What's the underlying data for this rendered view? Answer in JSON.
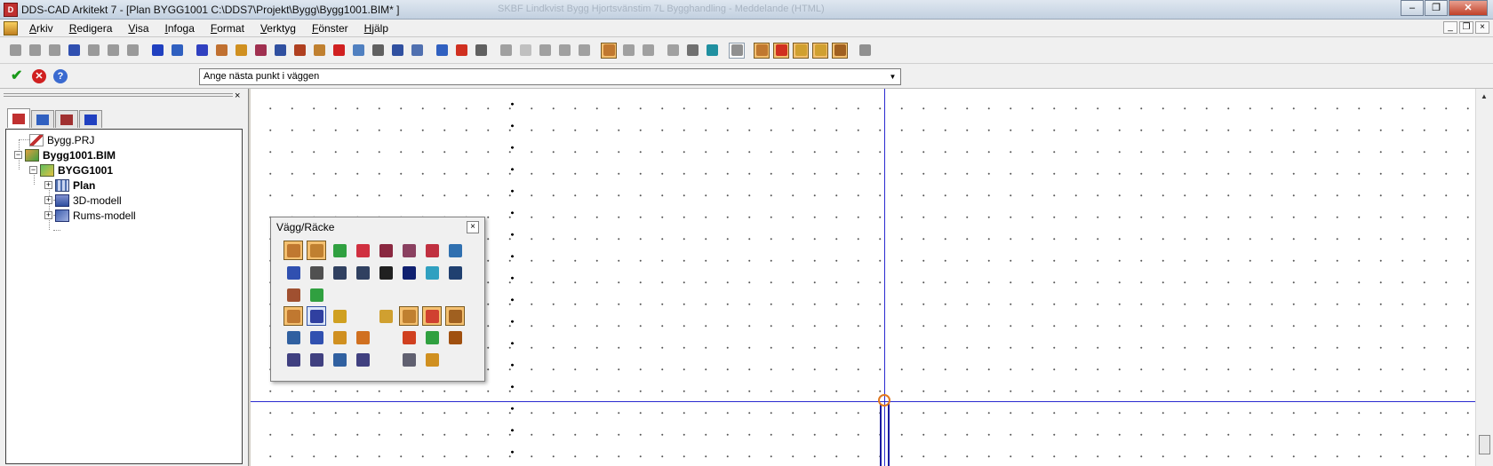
{
  "window": {
    "title": "DDS-CAD Arkitekt 7 - [Plan  BYGG1001  C:\\DDS7\\Projekt\\Bygg\\Bygg1001.BIM* ]",
    "background_title": "SKBF Lindkvist Bygg Hjortsvänstim 7L Bygghandling - Meddelande (HTML)"
  },
  "menu": [
    "Arkiv",
    "Redigera",
    "Visa",
    "Infoga",
    "Format",
    "Verktyg",
    "Fönster",
    "Hjälp"
  ],
  "toolbar": {
    "icons": [
      {
        "name": "copy-icon",
        "color": "#9a9a9a"
      },
      {
        "name": "paste-icon",
        "color": "#9a9a9a"
      },
      {
        "name": "cut-icon",
        "color": "#9a9a9a"
      },
      {
        "name": "save-icon",
        "color": "#3050b0"
      },
      {
        "name": "delete-icon",
        "color": "#9a9a9a"
      },
      {
        "name": "undo-icon",
        "color": "#9a9a9a"
      },
      {
        "name": "redo-icon",
        "color": "#9a9a9a"
      },
      {
        "name": "sep"
      },
      {
        "name": "globe-icon",
        "color": "#2040c0"
      },
      {
        "name": "home-icon",
        "color": "#3060c0"
      },
      {
        "name": "sep"
      },
      {
        "name": "help-icon",
        "color": "#3040c0"
      },
      {
        "name": "floor-plan-icon",
        "color": "#c07030"
      },
      {
        "name": "roof-icon",
        "color": "#d09020"
      },
      {
        "name": "stair-icon",
        "color": "#a03050"
      },
      {
        "name": "window-icon",
        "color": "#3050a0"
      },
      {
        "name": "house-icon",
        "color": "#b04020"
      },
      {
        "name": "beam-icon",
        "color": "#c08030"
      },
      {
        "name": "fire-icon",
        "color": "#d02020"
      },
      {
        "name": "layers-icon",
        "color": "#5080c0"
      },
      {
        "name": "cube-icon",
        "color": "#606060"
      },
      {
        "name": "render-icon",
        "color": "#3050a0"
      },
      {
        "name": "furniture-icon",
        "color": "#5070b0"
      },
      {
        "name": "sep"
      },
      {
        "name": "grid-icon",
        "color": "#3060c0"
      },
      {
        "name": "badge-icon",
        "color": "#d03020"
      },
      {
        "name": "tools-icon",
        "color": "#606060"
      },
      {
        "name": "sep"
      },
      {
        "name": "wall-icon",
        "color": "#a0a0a0"
      },
      {
        "name": "box-icon",
        "color": "#c0c0c0"
      },
      {
        "name": "ellipse-icon",
        "color": "#a0a0a0"
      },
      {
        "name": "cross-icon",
        "color": "#a0a0a0"
      },
      {
        "name": "polygon-icon",
        "color": "#a0a0a0"
      },
      {
        "name": "sep"
      },
      {
        "name": "area-hl-icon",
        "color": "#c07830",
        "hl": true
      },
      {
        "name": "shape-a-icon",
        "color": "#a0a0a0"
      },
      {
        "name": "shape-b-icon",
        "color": "#a0a0a0"
      },
      {
        "name": "sep"
      },
      {
        "name": "mesh-icon",
        "color": "#a0a0a0"
      },
      {
        "name": "camera-icon",
        "color": "#707070"
      },
      {
        "name": "copy-view-icon",
        "color": "#2090a0"
      },
      {
        "name": "sep"
      },
      {
        "name": "image-icon",
        "color": "#909090",
        "framed": true
      },
      {
        "name": "sep"
      },
      {
        "name": "wall-tool-icon",
        "color": "#c07830",
        "hl": true
      },
      {
        "name": "wall-select-icon",
        "color": "#d03020",
        "hl": true
      },
      {
        "name": "dots-icon",
        "color": "#d0a030",
        "hl": true
      },
      {
        "name": "dimension-icon",
        "color": "#d0a030",
        "hl": true
      },
      {
        "name": "column-icon",
        "color": "#a06020",
        "hl": true
      },
      {
        "name": "sep"
      },
      {
        "name": "settings-icon",
        "color": "#909090"
      }
    ]
  },
  "prompt": {
    "text": "Ange nästa punkt i väggen",
    "arrow": "▼"
  },
  "panel": {
    "tabs": [
      {
        "name": "tab-project",
        "color": "#c03030",
        "active": true
      },
      {
        "name": "tab-layers",
        "color": "#3060c0"
      },
      {
        "name": "tab-views",
        "color": "#a03030"
      },
      {
        "name": "tab-links",
        "color": "#2040c0"
      }
    ],
    "tree": {
      "project": "Bygg.PRJ",
      "model": "Bygg1001.BIM",
      "building": "BYGG1001",
      "children": [
        "Plan",
        "3D-modell",
        "Rums-modell"
      ]
    }
  },
  "palette": {
    "title": "Vägg/Räcke",
    "close": "×",
    "rows": [
      [
        {
          "name": "wall-corner-icon",
          "color": "#c07830",
          "hl": true
        },
        {
          "name": "wall-dots-icon",
          "color": "#c08030",
          "hl": true
        },
        {
          "name": "wall-align-icon",
          "color": "#30a040"
        },
        {
          "name": "railing-icon",
          "color": "#d03040"
        },
        {
          "name": "wall-panel-icon",
          "color": "#8a2840"
        },
        {
          "name": "wall-panel-b-icon",
          "color": "#8a4060"
        },
        {
          "name": "wall-frame-icon",
          "color": "#c03040"
        },
        {
          "name": "wall-window-icon",
          "color": "#3070b0"
        }
      ],
      [
        {
          "name": "measure-icon",
          "color": "#3050b0"
        },
        {
          "name": "polyline-icon",
          "color": "#505050"
        },
        {
          "name": "curve-icon",
          "color": "#304060"
        },
        {
          "name": "arc-icon",
          "color": "#304060"
        },
        {
          "name": "dashed-line-icon",
          "color": "#202020"
        },
        {
          "name": "double-line-icon",
          "color": "#102070"
        },
        {
          "name": "image-wall-icon",
          "color": "#30a0c0"
        },
        {
          "name": "cross-box-icon",
          "color": "#204070"
        }
      ],
      [
        {
          "name": "fence-icon",
          "color": "#a05030"
        },
        {
          "name": "join-icon",
          "color": "#30a040"
        }
      ],
      [
        {
          "name": "door-tool-icon",
          "color": "#c07830",
          "hl": true
        },
        {
          "name": "globe-tool-icon",
          "color": "#3040a0",
          "sel": true
        },
        {
          "name": "paint-icon",
          "color": "#d0a020"
        },
        {
          "name": "gap",
          "color": "#ffffff"
        },
        {
          "name": "split-icon",
          "color": "#d0a030"
        },
        {
          "name": "grid-tool-icon",
          "color": "#c08030",
          "hl": true
        },
        {
          "name": "trim-icon",
          "color": "#d04030",
          "hl": true
        },
        {
          "name": "extend-icon",
          "color": "#a06020",
          "hl": true
        }
      ],
      [
        {
          "name": "book-icon",
          "color": "#3060a0"
        },
        {
          "name": "measure-b-icon",
          "color": "#3050b0"
        },
        {
          "name": "plus-icon",
          "color": "#d09020"
        },
        {
          "name": "columns-icon",
          "color": "#d07020"
        },
        {
          "name": "gap",
          "color": "#ffffff"
        },
        {
          "name": "cut-wall-icon",
          "color": "#d04020"
        },
        {
          "name": "stack-icon",
          "color": "#30a040"
        },
        {
          "name": "move-icon",
          "color": "#a05010"
        }
      ],
      [
        {
          "name": "query-wall-icon",
          "color": "#404080"
        },
        {
          "name": "query-b-icon",
          "color": "#404080"
        },
        {
          "name": "query-c-icon",
          "color": "#3060a0"
        },
        {
          "name": "query-d-icon",
          "color": "#404080"
        },
        {
          "name": "gap",
          "color": "#ffffff"
        },
        {
          "name": "wall-edit-icon",
          "color": "#606070"
        },
        {
          "name": "brush-icon",
          "color": "#d09020"
        }
      ]
    ]
  }
}
